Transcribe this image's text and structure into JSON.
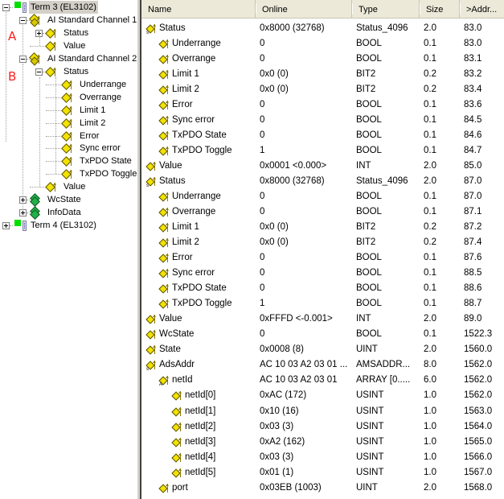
{
  "tree": {
    "markers": [
      "A",
      "B"
    ],
    "nodes": [
      {
        "label": "Term 3 (EL3102)",
        "kind": "terminal",
        "selected": true,
        "expander": "minus"
      },
      {
        "label": "AI Standard Channel 1",
        "kind": "var-group",
        "expander": "minus"
      },
      {
        "label": "Status",
        "kind": "var-struct",
        "expander": "plus"
      },
      {
        "label": "Value",
        "kind": "var"
      },
      {
        "label": "AI Standard Channel 2",
        "kind": "var-group",
        "expander": "minus"
      },
      {
        "label": "Status",
        "kind": "var-struct",
        "expander": "minus"
      },
      {
        "label": "Underrange",
        "kind": "var"
      },
      {
        "label": "Overrange",
        "kind": "var"
      },
      {
        "label": "Limit 1",
        "kind": "var"
      },
      {
        "label": "Limit 2",
        "kind": "var"
      },
      {
        "label": "Error",
        "kind": "var"
      },
      {
        "label": "Sync error",
        "kind": "var"
      },
      {
        "label": "TxPDO State",
        "kind": "var"
      },
      {
        "label": "TxPDO Toggle",
        "kind": "var"
      },
      {
        "label": "Value",
        "kind": "var"
      },
      {
        "label": "WcState",
        "kind": "green-group",
        "expander": "plus"
      },
      {
        "label": "InfoData",
        "kind": "green-group",
        "expander": "plus"
      },
      {
        "label": "Term 4 (EL3102)",
        "kind": "terminal",
        "expander": "plus"
      }
    ]
  },
  "table": {
    "columns": [
      "Name",
      "Online",
      "Type",
      "Size",
      ">Addr..."
    ],
    "rows": [
      {
        "name": "Status",
        "icon": "struct-var-icon",
        "online": "0x8000 (32768)",
        "type": "Status_4096",
        "size": "2.0",
        "addr": "83.0"
      },
      {
        "name": "Underrange",
        "icon": "var-icon",
        "online": "0",
        "type": "BOOL",
        "size": "0.1",
        "addr": "83.0"
      },
      {
        "name": "Overrange",
        "icon": "var-icon",
        "online": "0",
        "type": "BOOL",
        "size": "0.1",
        "addr": "83.1"
      },
      {
        "name": "Limit 1",
        "icon": "var-icon",
        "online": "0x0 (0)",
        "type": "BIT2",
        "size": "0.2",
        "addr": "83.2"
      },
      {
        "name": "Limit 2",
        "icon": "var-icon",
        "online": "0x0 (0)",
        "type": "BIT2",
        "size": "0.2",
        "addr": "83.4"
      },
      {
        "name": "Error",
        "icon": "var-icon",
        "online": "0",
        "type": "BOOL",
        "size": "0.1",
        "addr": "83.6"
      },
      {
        "name": "Sync error",
        "icon": "var-icon",
        "online": "0",
        "type": "BOOL",
        "size": "0.1",
        "addr": "84.5"
      },
      {
        "name": "TxPDO State",
        "icon": "var-icon",
        "online": "0",
        "type": "BOOL",
        "size": "0.1",
        "addr": "84.6"
      },
      {
        "name": "TxPDO Toggle",
        "icon": "var-icon",
        "online": "1",
        "type": "BOOL",
        "size": "0.1",
        "addr": "84.7"
      },
      {
        "name": "Value",
        "icon": "var-icon",
        "online": "0x0001 <0.000>",
        "type": "INT",
        "size": "2.0",
        "addr": "85.0"
      },
      {
        "name": "Status",
        "icon": "struct-var-icon",
        "online": "0x8000 (32768)",
        "type": "Status_4096",
        "size": "2.0",
        "addr": "87.0"
      },
      {
        "name": "Underrange",
        "icon": "var-icon",
        "online": "0",
        "type": "BOOL",
        "size": "0.1",
        "addr": "87.0"
      },
      {
        "name": "Overrange",
        "icon": "var-icon",
        "online": "0",
        "type": "BOOL",
        "size": "0.1",
        "addr": "87.1"
      },
      {
        "name": "Limit 1",
        "icon": "var-icon",
        "online": "0x0 (0)",
        "type": "BIT2",
        "size": "0.2",
        "addr": "87.2"
      },
      {
        "name": "Limit 2",
        "icon": "var-icon",
        "online": "0x0 (0)",
        "type": "BIT2",
        "size": "0.2",
        "addr": "87.4"
      },
      {
        "name": "Error",
        "icon": "var-icon",
        "online": "0",
        "type": "BOOL",
        "size": "0.1",
        "addr": "87.6"
      },
      {
        "name": "Sync error",
        "icon": "var-icon",
        "online": "0",
        "type": "BOOL",
        "size": "0.1",
        "addr": "88.5"
      },
      {
        "name": "TxPDO State",
        "icon": "var-icon",
        "online": "0",
        "type": "BOOL",
        "size": "0.1",
        "addr": "88.6"
      },
      {
        "name": "TxPDO Toggle",
        "icon": "var-icon",
        "online": "1",
        "type": "BOOL",
        "size": "0.1",
        "addr": "88.7"
      },
      {
        "name": "Value",
        "icon": "var-icon",
        "online": "0xFFFD <-0.001>",
        "type": "INT",
        "size": "2.0",
        "addr": "89.0"
      },
      {
        "name": "WcState",
        "icon": "var-icon",
        "online": "0",
        "type": "BOOL",
        "size": "0.1",
        "addr": "1522.3"
      },
      {
        "name": "State",
        "icon": "var-icon",
        "online": "0x0008 (8)",
        "type": "UINT",
        "size": "2.0",
        "addr": "1560.0"
      },
      {
        "name": "AdsAddr",
        "icon": "struct-var-icon",
        "online": "AC 10 03 A2 03 01 ...",
        "type": "AMSADDR...",
        "size": "8.0",
        "addr": "1562.0"
      },
      {
        "name": "netId",
        "icon": "array-var-icon",
        "online": "AC 10 03 A2 03 01",
        "type": "ARRAY [0.....",
        "size": "6.0",
        "addr": "1562.0"
      },
      {
        "name": "netId[0]",
        "icon": "var-icon",
        "online": "0xAC (172)",
        "type": "USINT",
        "size": "1.0",
        "addr": "1562.0"
      },
      {
        "name": "netId[1]",
        "icon": "var-icon",
        "online": "0x10 (16)",
        "type": "USINT",
        "size": "1.0",
        "addr": "1563.0"
      },
      {
        "name": "netId[2]",
        "icon": "var-icon",
        "online": "0x03 (3)",
        "type": "USINT",
        "size": "1.0",
        "addr": "1564.0"
      },
      {
        "name": "netId[3]",
        "icon": "var-icon",
        "online": "0xA2 (162)",
        "type": "USINT",
        "size": "1.0",
        "addr": "1565.0"
      },
      {
        "name": "netId[4]",
        "icon": "var-icon",
        "online": "0x03 (3)",
        "type": "USINT",
        "size": "1.0",
        "addr": "1566.0"
      },
      {
        "name": "netId[5]",
        "icon": "var-icon",
        "online": "0x01 (1)",
        "type": "USINT",
        "size": "1.0",
        "addr": "1567.0"
      },
      {
        "name": "port",
        "icon": "var-icon",
        "online": "0x03EB (1003)",
        "type": "UINT",
        "size": "2.0",
        "addr": "1568.0"
      }
    ]
  }
}
